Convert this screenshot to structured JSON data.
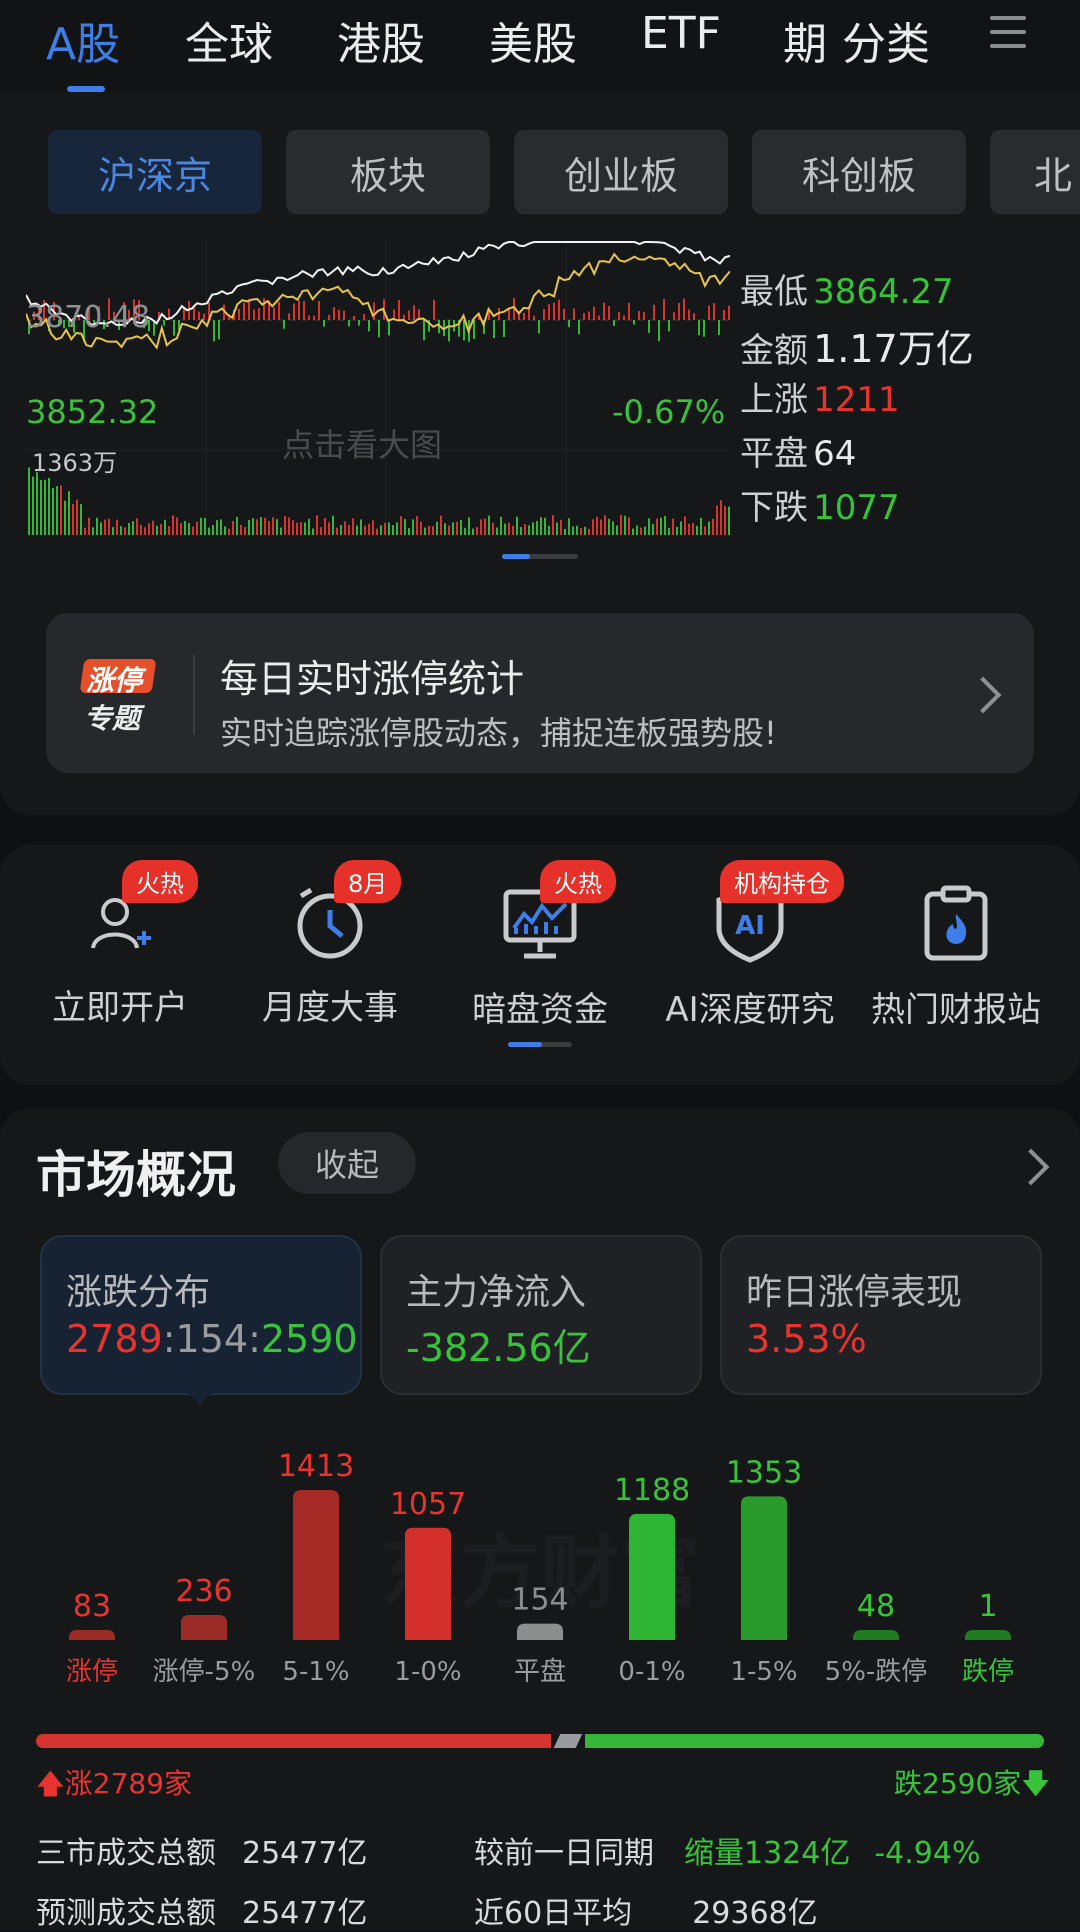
{
  "top_tabs": [
    "A股",
    "全球",
    "港股",
    "美股",
    "ETF",
    "期",
    "分类"
  ],
  "sub_tabs": [
    "沪深京",
    "板块",
    "创业板",
    "科创板",
    "北"
  ],
  "chart": {
    "upper_left": "3870.48",
    "lower_left": "3852.32",
    "lower_right_pct": "-0.67%",
    "volume_label": "1363万",
    "hint": "点击看大图",
    "stats": [
      {
        "label": "最低",
        "value": "3864.27",
        "color": "green"
      },
      {
        "label": "金额",
        "value": "1.17万亿",
        "color": "white"
      },
      {
        "label": "上涨",
        "value": "1211",
        "color": "red"
      },
      {
        "label": "平盘",
        "value": "64",
        "color": "white"
      },
      {
        "label": "下跌",
        "value": "1077",
        "color": "green"
      }
    ]
  },
  "banner": {
    "icon_top": "涨停",
    "icon_bottom": "专题",
    "title": "每日实时涨停统计",
    "subtitle": "实时追踪涨停股动态，捕捉连板强势股!"
  },
  "quick_entries": [
    {
      "label": "立即开户",
      "badge": "火热",
      "icon": "add-user-icon"
    },
    {
      "label": "月度大事",
      "badge": "8月",
      "icon": "clock-icon"
    },
    {
      "label": "暗盘资金",
      "badge": "火热",
      "icon": "monitor-chart-icon"
    },
    {
      "label": "AI深度研究",
      "badge": "机构持仓",
      "icon": "ai-shield-icon"
    },
    {
      "label": "热门财报站",
      "badge": "",
      "icon": "clipboard-fire-icon"
    }
  ],
  "market": {
    "title": "市场概况",
    "collapse": "收起",
    "cards": [
      {
        "title": "涨跌分布",
        "value_up": "2789",
        "value_flat": "154",
        "value_down": "2590"
      },
      {
        "title": "主力净流入",
        "value": "-382.56亿"
      },
      {
        "title": "昨日涨停表现",
        "value": "3.53%"
      }
    ]
  },
  "chart_data": {
    "type": "bar",
    "categories": [
      "涨停",
      "涨停-5%",
      "5-1%",
      "1-0%",
      "平盘",
      "0-1%",
      "1-5%",
      "5%-跌停",
      "跌停"
    ],
    "values": [
      83,
      236,
      1413,
      1057,
      154,
      1188,
      1353,
      48,
      1
    ],
    "colors": [
      "#9b2b27",
      "#9b2b27",
      "#a62a26",
      "#d4302b",
      "#8d8d8d",
      "#2fb534",
      "#2a9a2d",
      "#1f7a22",
      "#1f7a22"
    ],
    "value_colors": [
      "#e8342f",
      "#e8342f",
      "#e8342f",
      "#e8342f",
      "#8d8d8d",
      "#37c43a",
      "#37c43a",
      "#37c43a",
      "#37c43a"
    ]
  },
  "summary": {
    "up_text": "涨2789家",
    "down_text": "跌2590家",
    "up_ratio": 0.519,
    "rows": [
      {
        "l1": "三市成交总额",
        "v1": "25477亿",
        "l2": "较前一日同期",
        "v2": "缩量1324亿",
        "v3": "-4.94%"
      },
      {
        "l1": "预测成交总额",
        "v1": "25477亿",
        "l2": "近60日平均",
        "v2": "29368亿",
        "v3": ""
      }
    ]
  }
}
